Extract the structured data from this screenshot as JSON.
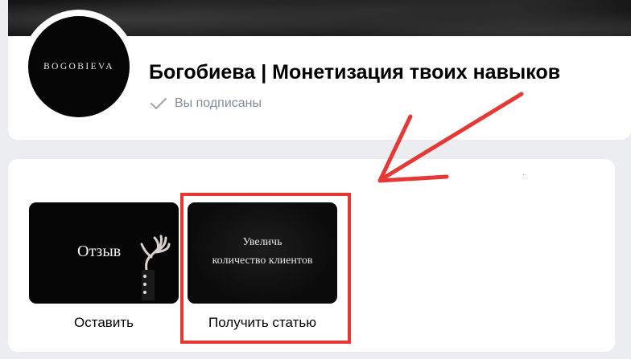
{
  "community": {
    "avatar_text": "BOGOBIEVA",
    "title": "Богобиева | Монетизация твоих навыков",
    "subscribed_label": "Вы подписаны"
  },
  "tiles": [
    {
      "image_text": "Отзыв",
      "caption": "Оставить"
    },
    {
      "image_text_lines": [
        "Увеличь",
        "количество клиентов"
      ],
      "caption": "Получить статью"
    }
  ],
  "colors": {
    "annotation_red": "#e53935",
    "page_bg": "#ebedf0",
    "muted_text": "#818c99"
  }
}
